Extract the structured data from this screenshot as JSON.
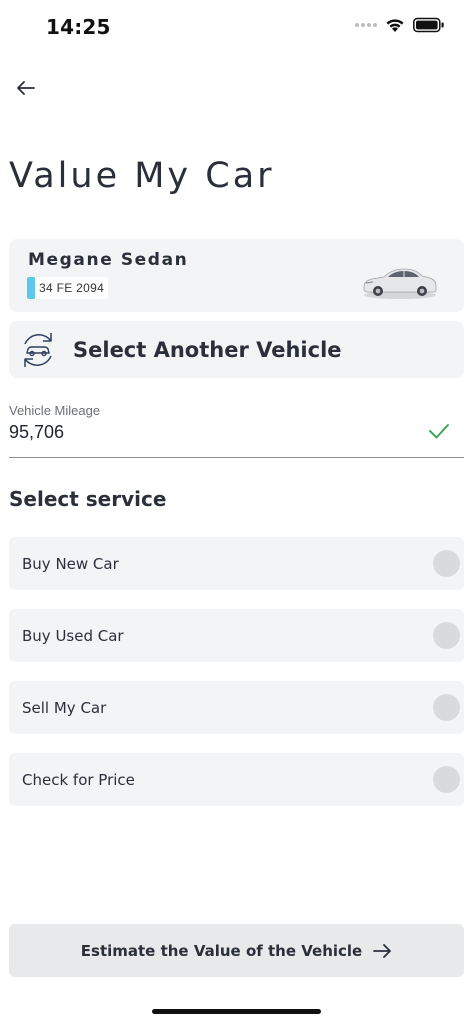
{
  "status_bar": {
    "time": "14:25"
  },
  "header": {
    "title": "Value My Car"
  },
  "vehicle": {
    "name": "Megane Sedan",
    "plate": "34 FE 2094"
  },
  "select_vehicle": {
    "label": "Select Another Vehicle"
  },
  "mileage": {
    "label": "Vehicle Mileage",
    "value": "95,706"
  },
  "services": {
    "title": "Select service",
    "options": [
      {
        "label": "Buy New Car",
        "selected": false
      },
      {
        "label": "Buy Used Car",
        "selected": false
      },
      {
        "label": "Sell My Car",
        "selected": false
      },
      {
        "label": "Check for Price",
        "selected": false
      }
    ]
  },
  "footer": {
    "estimate_label": "Estimate the Value of the Vehicle"
  },
  "colors": {
    "plate_strip": "#5ec8e8",
    "check": "#3fa55c",
    "card_bg": "#f3f4f6"
  }
}
